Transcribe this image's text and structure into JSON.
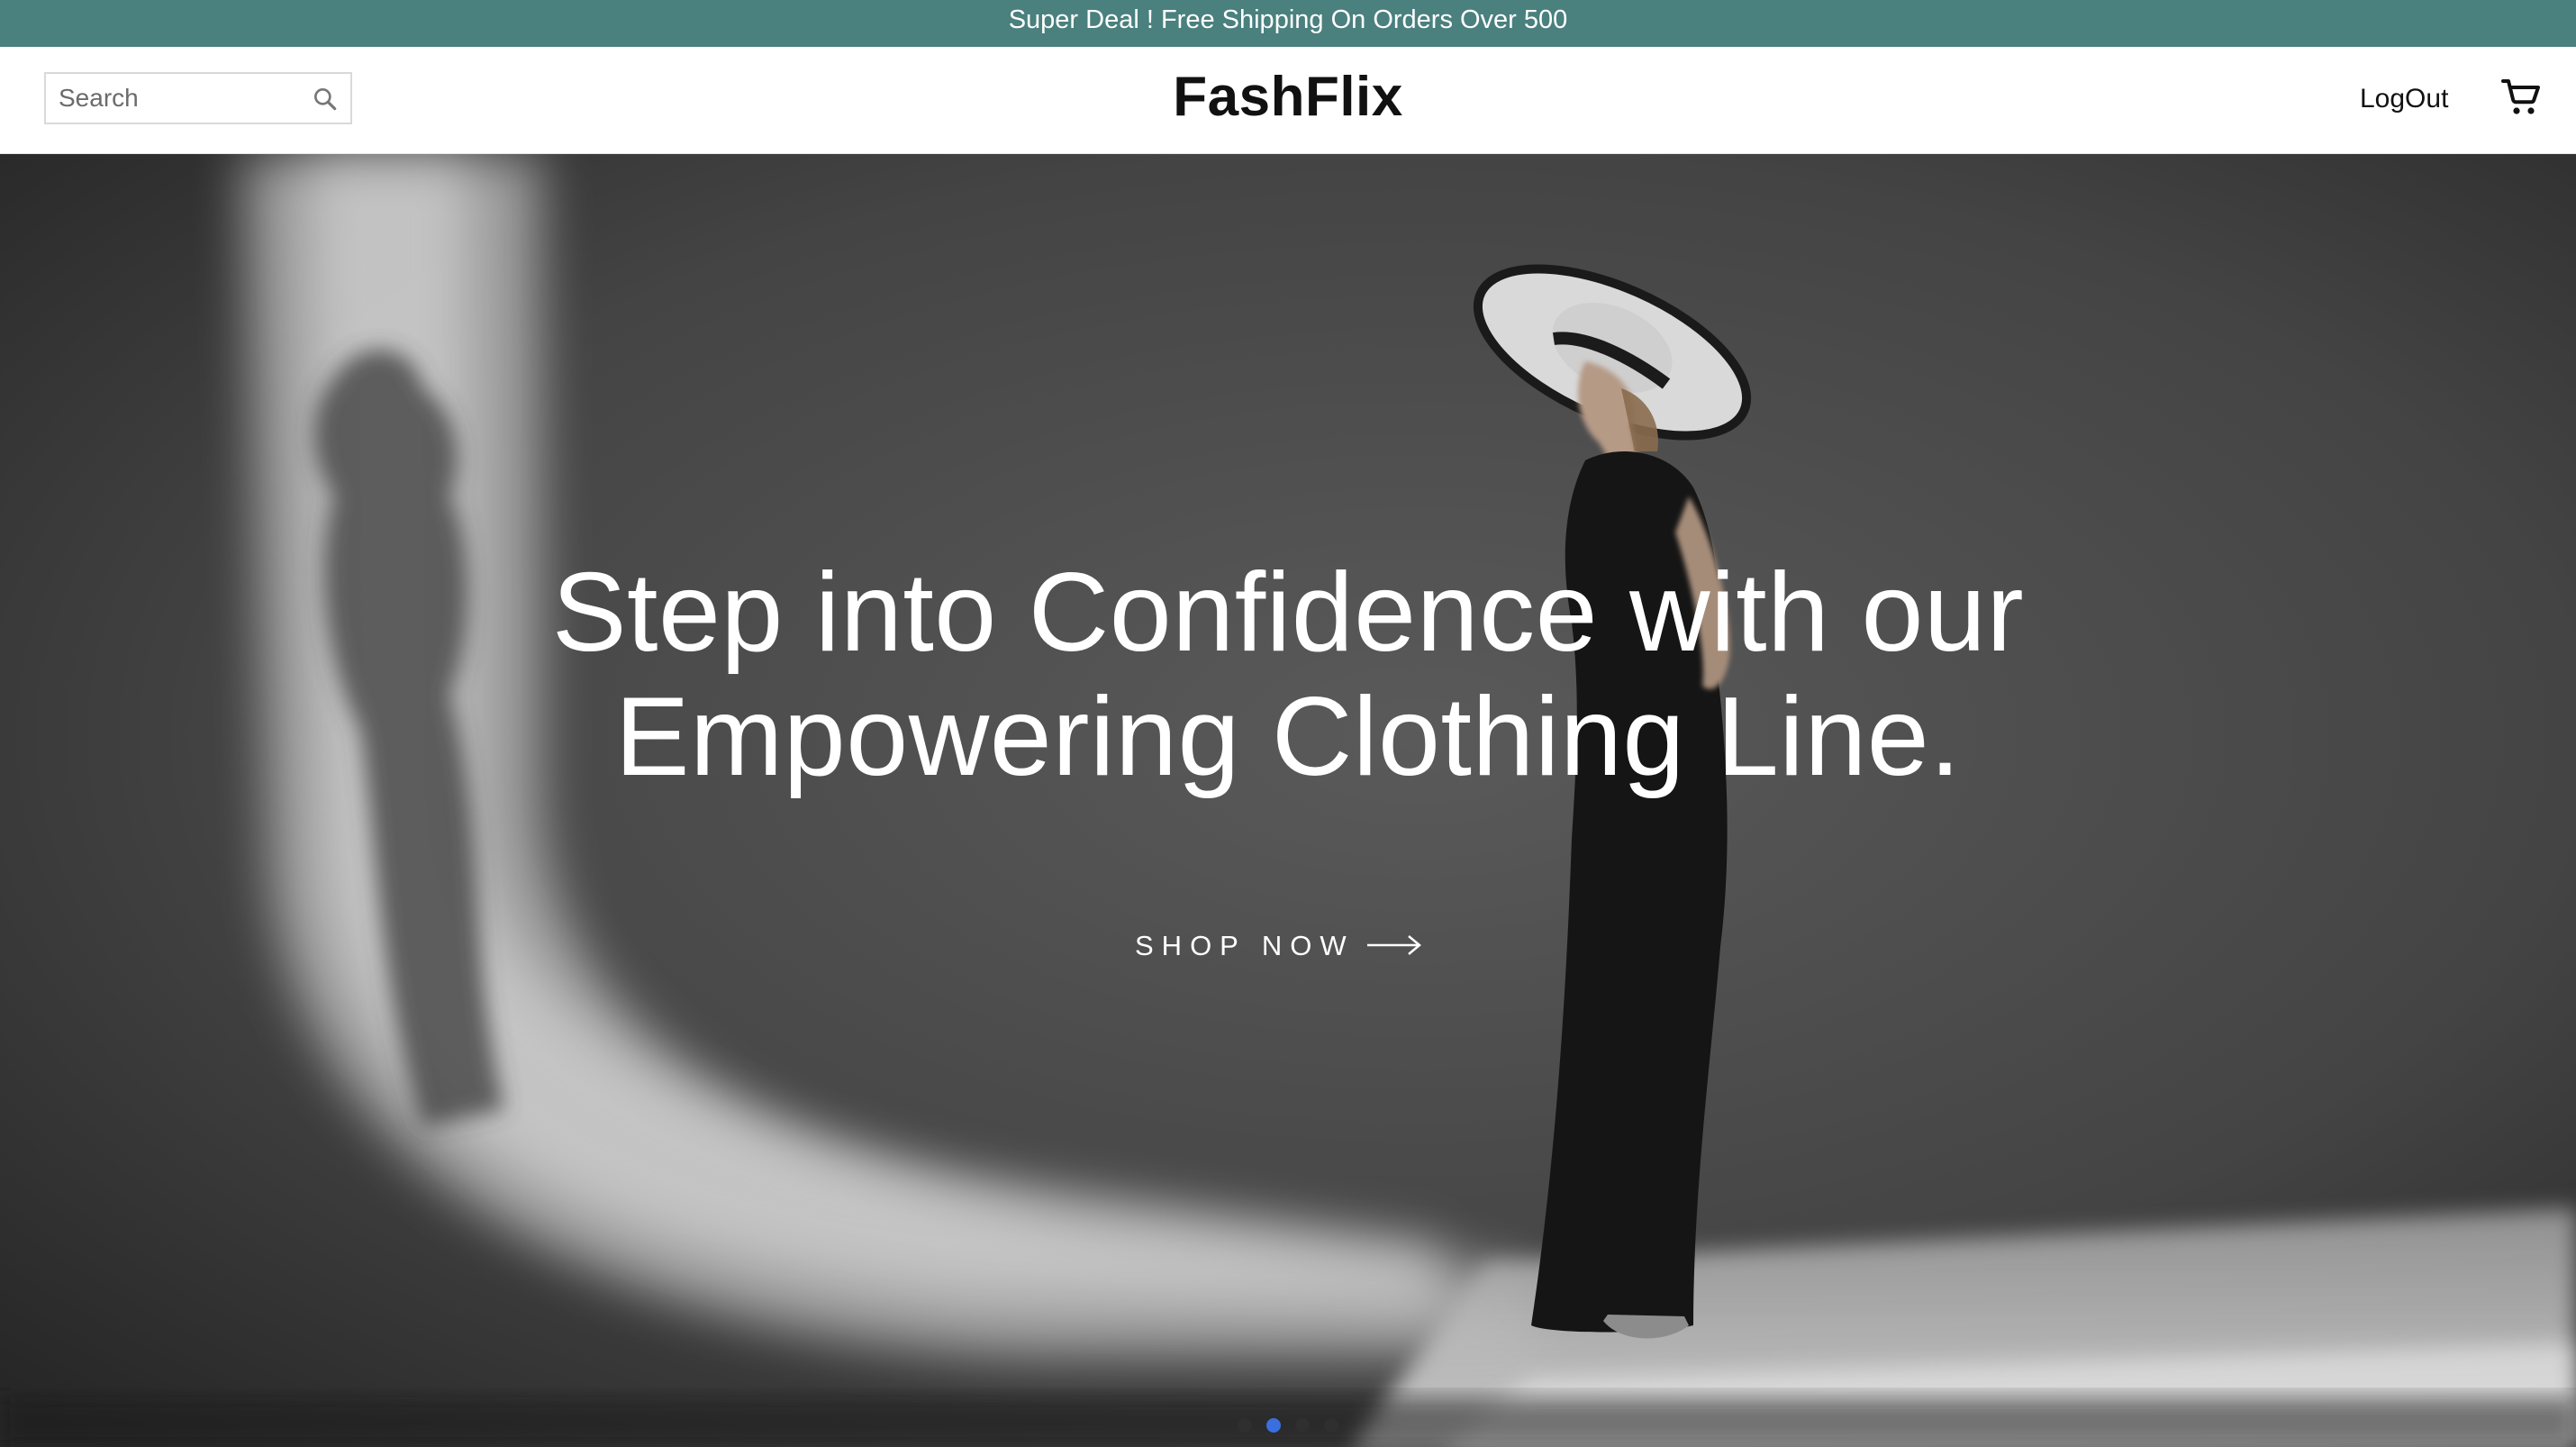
{
  "announcement": {
    "text": "Super Deal ! Free Shipping On Orders Over 500"
  },
  "header": {
    "search": {
      "placeholder": "Search"
    },
    "logo": "FashFlix",
    "logout_label": "LogOut",
    "icons": {
      "search": "search-icon",
      "cart": "shopping-cart-icon"
    }
  },
  "hero": {
    "title_line1": "Step into Confidence with our",
    "title_line2": "Empowering Clothing Line.",
    "cta_label": "SHOP NOW",
    "cta_icon": "arrow-right-icon",
    "slides": {
      "count": 4,
      "active_index": 1
    }
  },
  "colors": {
    "announcement_bg": "#4a807e",
    "active_dot": "#3b6fe0",
    "hero_text": "#ffffff"
  }
}
